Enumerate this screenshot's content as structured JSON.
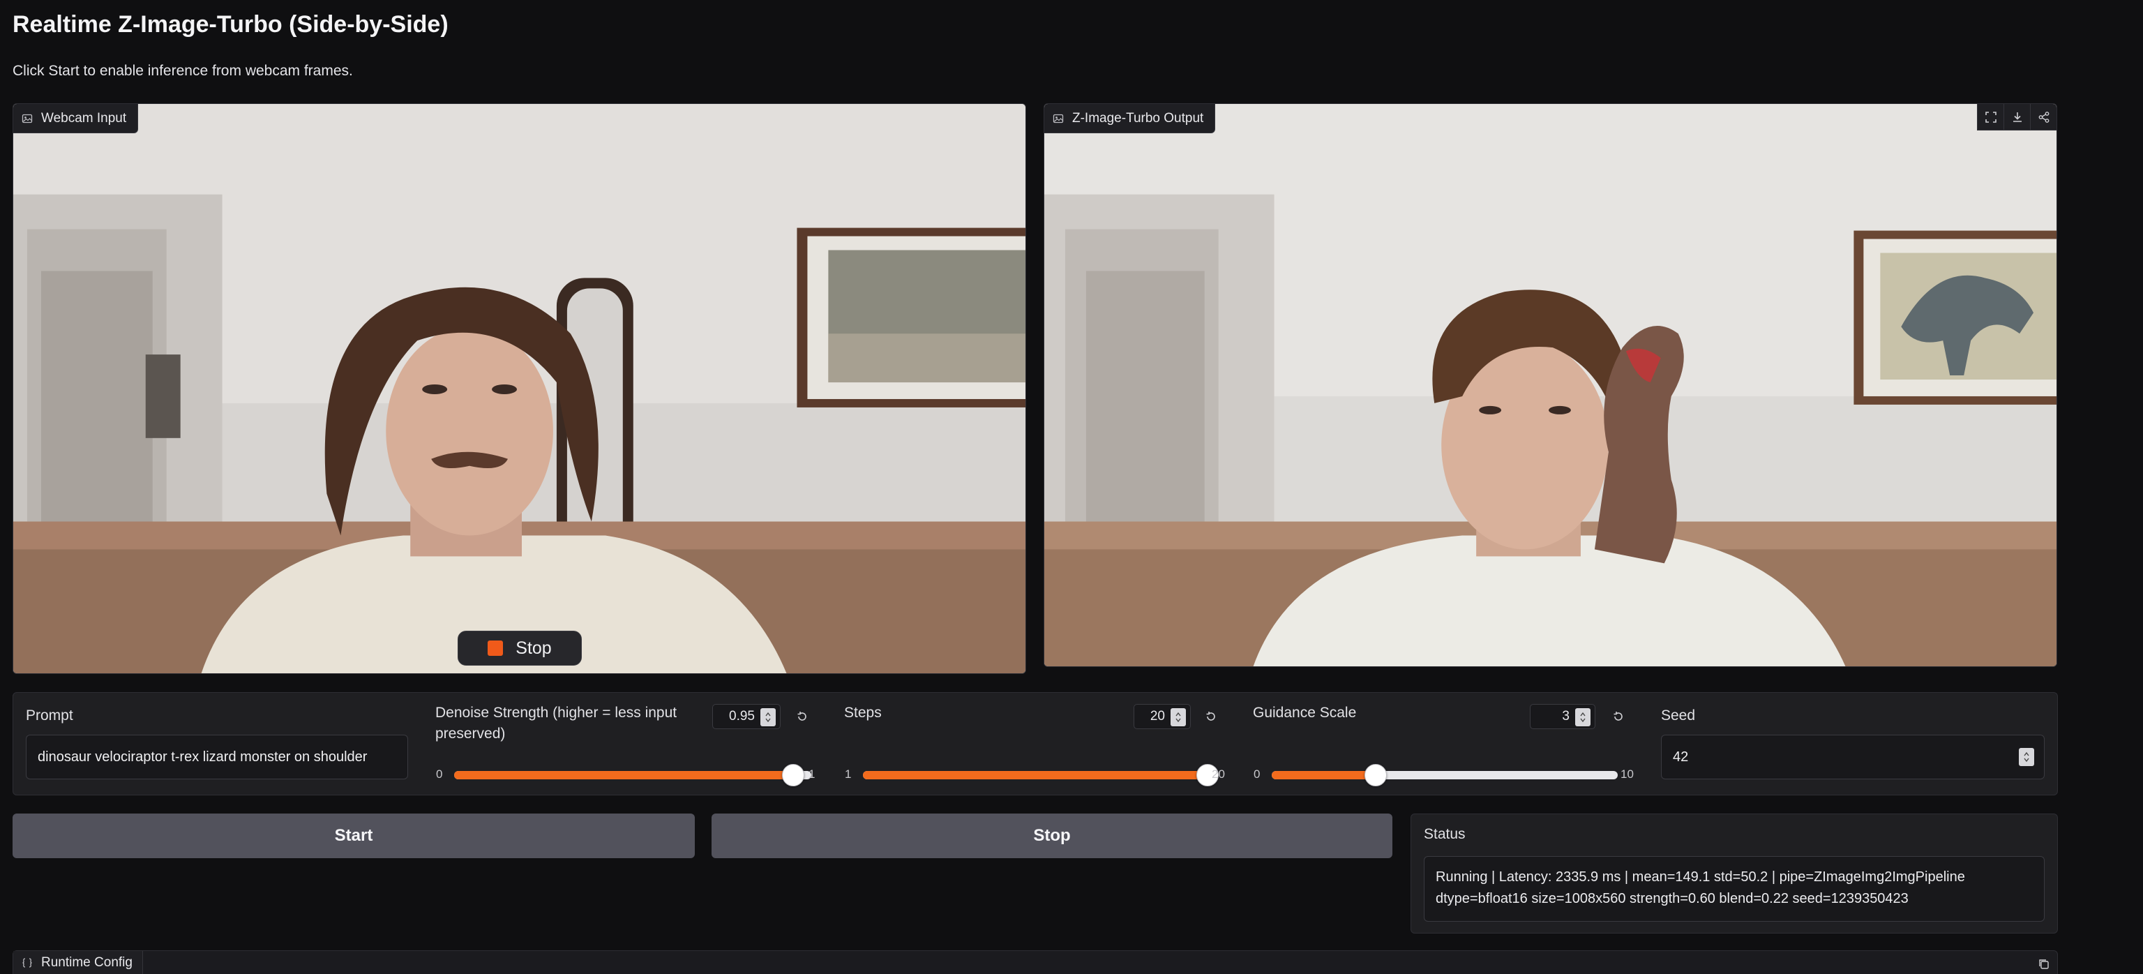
{
  "page": {
    "title": "Realtime Z-Image-Turbo (Side-by-Side)",
    "description": "Click Start to enable inference from webcam frames."
  },
  "webcam_panel": {
    "label": "Webcam Input",
    "label_icon": "image-icon",
    "stop_label": "Stop",
    "stop_icon": "stop-square-icon"
  },
  "output_panel": {
    "label": "Z-Image-Turbo Output",
    "label_icon": "image-icon",
    "tools": [
      "fullscreen-icon",
      "download-icon",
      "share-icon"
    ]
  },
  "controls": {
    "prompt": {
      "label": "Prompt",
      "value": "dinosaur velociraptor t-rex lizard monster on shoulder"
    },
    "denoise": {
      "label": "Denoise Strength (higher = less input preserved)",
      "value": "0.95",
      "min": "0",
      "max": "1",
      "fraction": 0.95
    },
    "steps": {
      "label": "Steps",
      "value": "20",
      "min": "1",
      "max": "20",
      "fraction": 1.0
    },
    "guidance": {
      "label": "Guidance Scale",
      "value": "3",
      "min": "0",
      "max": "10",
      "fraction": 0.3
    },
    "seed": {
      "label": "Seed",
      "value": "42"
    }
  },
  "buttons": {
    "start_label": "Start",
    "stop_label": "Stop"
  },
  "status": {
    "label": "Status",
    "line1": "Running | Latency: 2335.9 ms | mean=149.1 std=50.2 | pipe=ZImageImg2ImgPipeline",
    "line2": "dtype=bfloat16 size=1008x560 strength=0.60 blend=0.22 seed=1239350423"
  },
  "runtime": {
    "label": "Runtime Config",
    "icon": "code-braces-icon",
    "copy_icon": "copy-icon"
  },
  "colors": {
    "accent": "#f26b1d",
    "background": "#0f0f11",
    "panel": "#1f1f22",
    "button": "#52525c"
  }
}
